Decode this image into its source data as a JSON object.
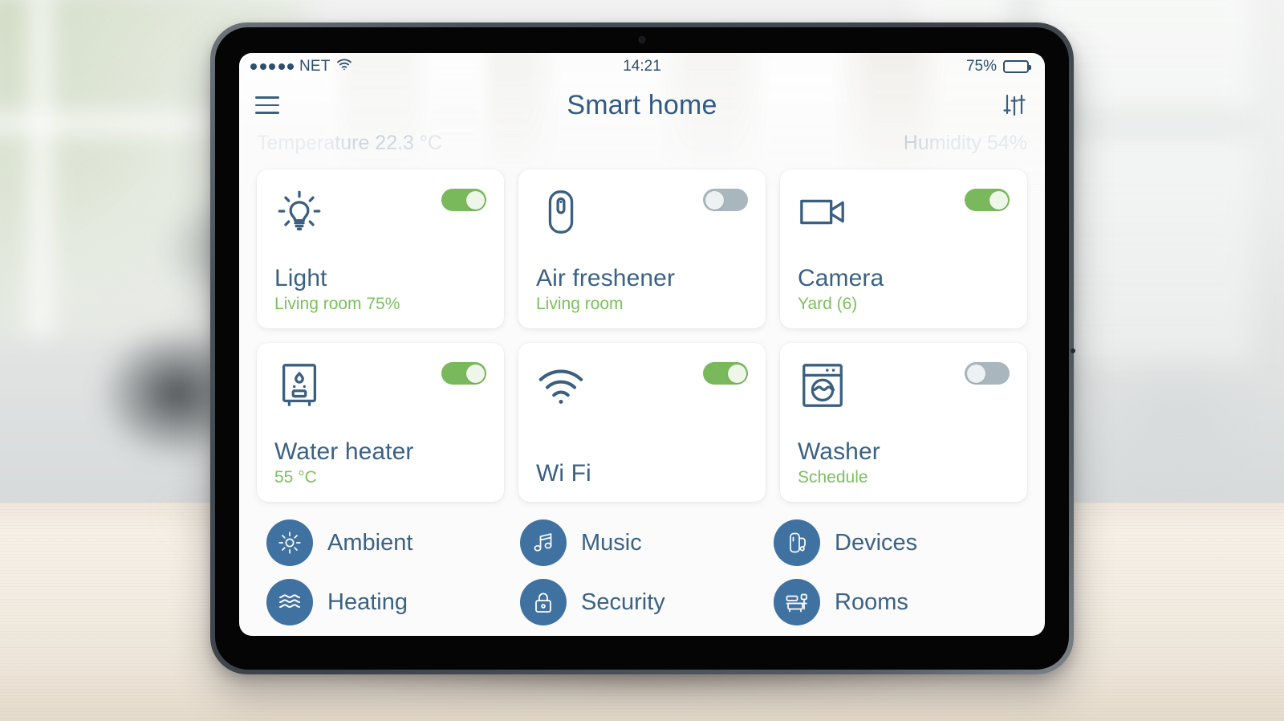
{
  "status_bar": {
    "signal_dots": 5,
    "carrier": "NET",
    "wifi_icon": "wifi-icon",
    "time": "14:21",
    "battery_percent": "75%",
    "battery_level": 75
  },
  "header": {
    "menu_icon": "hamburger-menu-icon",
    "title": "Smart home",
    "settings_icon": "sliders-icon"
  },
  "environment": {
    "temperature": "Temperature 22.3 °C",
    "humidity": "Humidity 54%"
  },
  "colors": {
    "toggle_on": "#79b85b",
    "toggle_off": "#aab6bd",
    "title_blue": "#3b6184",
    "subtitle_green": "#7cc05e",
    "menu_circle": "#3f72a0"
  },
  "devices": [
    {
      "icon": "lightbulb-icon",
      "title": "Light",
      "subtitle": "Living room 75%",
      "state": "on"
    },
    {
      "icon": "air-freshener-icon",
      "title": "Air freshener",
      "subtitle": "Living room",
      "state": "off"
    },
    {
      "icon": "video-camera-icon",
      "title": "Camera",
      "subtitle": "Yard (6)",
      "state": "on"
    },
    {
      "icon": "water-heater-icon",
      "title": "Water heater",
      "subtitle": "55 °C",
      "state": "on"
    },
    {
      "icon": "wifi-icon",
      "title": "Wi Fi",
      "subtitle": "",
      "state": "on"
    },
    {
      "icon": "washer-icon",
      "title": "Washer",
      "subtitle": "Schedule",
      "state": "off"
    }
  ],
  "menu": [
    {
      "icon": "sun-icon",
      "label": "Ambient"
    },
    {
      "icon": "music-note-icon",
      "label": "Music"
    },
    {
      "icon": "plug-icon",
      "label": "Devices"
    },
    {
      "icon": "waves-icon",
      "label": "Heating"
    },
    {
      "icon": "lock-icon",
      "label": "Security"
    },
    {
      "icon": "sofa-icon",
      "label": "Rooms"
    }
  ]
}
